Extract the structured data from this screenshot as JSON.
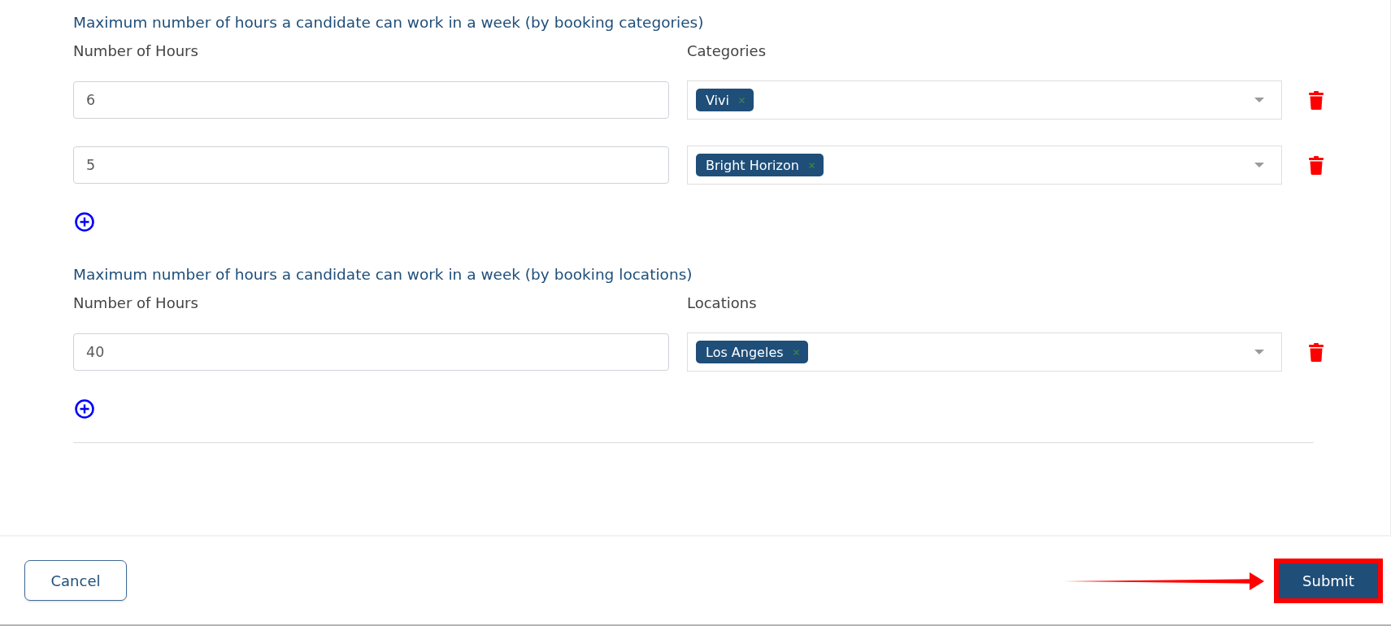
{
  "sections": [
    {
      "title": "Maximum number of hours a candidate can work in a week (by booking categories)",
      "hours_label": "Number of Hours",
      "select_label": "Categories",
      "rows": [
        {
          "hours": "6",
          "tags": [
            "Vivi"
          ]
        },
        {
          "hours": "5",
          "tags": [
            "Bright Horizon"
          ]
        }
      ]
    },
    {
      "title": "Maximum number of hours a candidate can work in a week (by booking locations)",
      "hours_label": "Number of Hours",
      "select_label": "Locations",
      "rows": [
        {
          "hours": "40",
          "tags": [
            "Los Angeles"
          ]
        }
      ]
    }
  ],
  "footer": {
    "buttons": [
      {
        "label": "Cancel",
        "kind": "secondary",
        "highlighted": false
      },
      {
        "label": "Submit",
        "kind": "primary",
        "highlighted": true
      }
    ]
  }
}
